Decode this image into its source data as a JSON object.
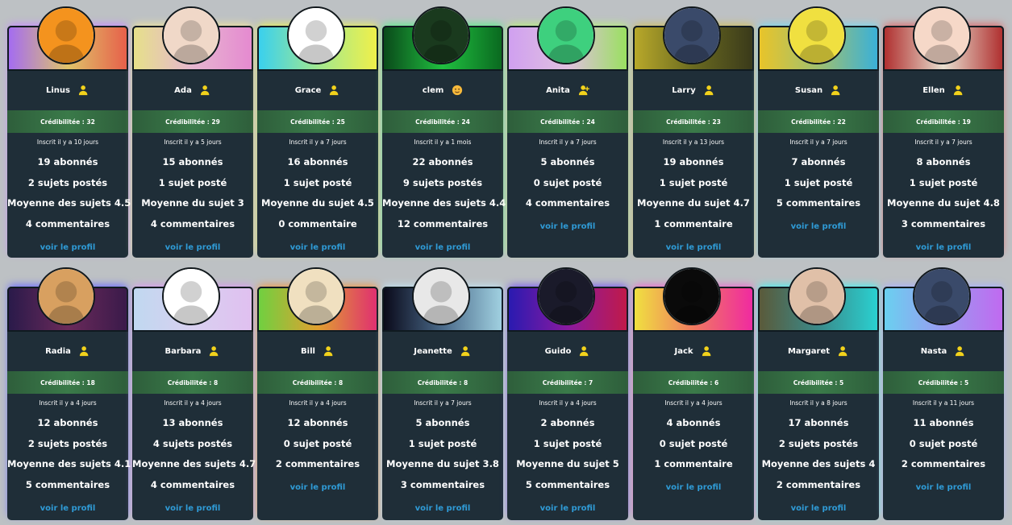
{
  "rows": [
    [
      {
        "name": "Linus",
        "icon": "user-icon",
        "cred": "Crédibilitée : 32",
        "inscrit": "Inscrit il y a 10 jours",
        "stats": [
          "19 abonnés",
          "2 sujets postés",
          "Moyenne des sujets 4.5",
          "4 commentaires"
        ],
        "link": "voir le profil",
        "banner": [
          "#a46cf0",
          "#e0c46a",
          "#e6604a"
        ],
        "glow": "#c78bff",
        "avatar_color": "#f4931e"
      },
      {
        "name": "Ada",
        "icon": "user-icon",
        "cred": "Crédibilitée : 29",
        "inscrit": "Inscrit il y a 5 jours",
        "stats": [
          "15 abonnés",
          "1 sujet posté",
          "Moyenne du sujet 3",
          "4 commentaires"
        ],
        "link": "voir le profil",
        "banner": [
          "#e6e08a",
          "#e6b6d0",
          "#e58ad0"
        ],
        "glow": "#f0e49a",
        "avatar_color": "#f0d8c8"
      },
      {
        "name": "Grace",
        "icon": "user-icon",
        "cred": "Crédibilitée : 25",
        "inscrit": "Inscrit il y a 7 jours",
        "stats": [
          "16 abonnés",
          "1 sujet posté",
          "Moyenne du sujet 4.5",
          "0 commentaire"
        ],
        "link": "voir le profil",
        "banner": [
          "#3ad0ee",
          "#a0e890",
          "#f0f04a"
        ],
        "glow": "#e8f05a",
        "avatar_color": "#ffffff"
      },
      {
        "name": "clem",
        "icon": "emoji-icon",
        "cred": "Crédibilitée : 24",
        "inscrit": "Inscrit il y a 1 mois",
        "stats": [
          "22 abonnés",
          "9 sujets postés",
          "Moyenne des sujets 4.4",
          "12 commentaires"
        ],
        "link": "voir le profil",
        "banner": [
          "#0a4a1a",
          "#20c040",
          "#0a6a20"
        ],
        "glow": "#5af08a",
        "avatar_color": "#1a3a1e"
      },
      {
        "name": "Anita",
        "icon": "user-plus-icon",
        "cred": "Crédibilitée : 24",
        "inscrit": "Inscrit il y a 7 jours",
        "stats": [
          "5 abonnés",
          "0 sujet posté",
          "4 commentaires",
          ""
        ],
        "link": "voir le profil",
        "banner": [
          "#d0a0f0",
          "#e0c0e0",
          "#9ae060"
        ],
        "glow": "#b8f07a",
        "avatar_color": "#3ed07e"
      },
      {
        "name": "Larry",
        "icon": "user-icon",
        "cred": "Crédibilitée : 23",
        "inscrit": "Inscrit il y a 13 jours",
        "stats": [
          "19 abonnés",
          "1 sujet posté",
          "Moyenne du sujet 4.7",
          "1 commentaire"
        ],
        "link": "voir le profil",
        "banner": [
          "#b8a82a",
          "#6a6a20",
          "#3a3a1a"
        ],
        "glow": "#d0c060",
        "avatar_color": "#3a4a6a"
      },
      {
        "name": "Susan",
        "icon": "user-icon",
        "cred": "Crédibilitée : 22",
        "inscrit": "Inscrit il y a 7 jours",
        "stats": [
          "7 abonnés",
          "1 sujet posté",
          "5 commentaires",
          ""
        ],
        "link": "voir le profil",
        "banner": [
          "#e8c42a",
          "#a0c070",
          "#3ab0d8"
        ],
        "glow": "#7ad8f0",
        "avatar_color": "#f0e040"
      },
      {
        "name": "Ellen",
        "icon": "user-icon",
        "cred": "Crédibilitée : 19",
        "inscrit": "Inscrit il y a 7 jours",
        "stats": [
          "8 abonnés",
          "1 sujet posté",
          "Moyenne du sujet 4.8",
          "3 commentaires"
        ],
        "link": "voir le profil",
        "banner": [
          "#b03030",
          "#e8e0d0",
          "#b03030"
        ],
        "glow": "#e06a6a",
        "avatar_color": "#f6d8c8"
      }
    ],
    [
      {
        "name": "Radia",
        "icon": "user-icon",
        "cred": "Crédibilitée : 18",
        "inscrit": "Inscrit il y a 4 jours",
        "stats": [
          "12 abonnés",
          "2 sujets postés",
          "Moyenne des sujets 4.1",
          "5 commentaires"
        ],
        "link": "voir le profil",
        "banner": [
          "#2a1a4a",
          "#6a2a5a",
          "#3a1a4a"
        ],
        "glow": "#6a6aff",
        "avatar_color": "#d8a060"
      },
      {
        "name": "Barbara",
        "icon": "user-icon",
        "cred": "Crédibilitée : 8",
        "inscrit": "Inscrit il y a 4 jours",
        "stats": [
          "13 abonnés",
          "4 sujets postés",
          "Moyenne des sujets 4.7",
          "4 commentaires"
        ],
        "link": "voir le profil",
        "banner": [
          "#c0d8f0",
          "#d8d0f0",
          "#e0c0f0"
        ],
        "glow": "#d89af0",
        "avatar_color": "#ffffff"
      },
      {
        "name": "Bill",
        "icon": "user-icon",
        "cred": "Crédibilitée : 8",
        "inscrit": "Inscrit il y a 4 jours",
        "stats": [
          "12 abonnés",
          "0 sujet posté",
          "2 commentaires",
          ""
        ],
        "link": "voir le profil",
        "banner": [
          "#70d040",
          "#e0a030",
          "#e03070"
        ],
        "glow": "#f09a4a",
        "avatar_color": "#f0e0c0"
      },
      {
        "name": "Jeanette",
        "icon": "user-icon",
        "cred": "Crédibilitée : 8",
        "inscrit": "Inscrit il y a 7 jours",
        "stats": [
          "5 abonnés",
          "1 sujet posté",
          "Moyenne du sujet 3.8",
          "3 commentaires"
        ],
        "link": "voir le profil",
        "banner": [
          "#0a0a1a",
          "#4a6a8a",
          "#a0d0e0"
        ],
        "glow": "#c0e0f0",
        "avatar_color": "#e8e8e8"
      },
      {
        "name": "Guido",
        "icon": "user-icon",
        "cred": "Crédibilitée : 7",
        "inscrit": "Inscrit il y a 4 jours",
        "stats": [
          "2 abonnés",
          "1 sujet posté",
          "Moyenne du sujet 5",
          "5 commentaires"
        ],
        "link": "voir le profil",
        "banner": [
          "#2a1ab0",
          "#8a1aa0",
          "#c01a4a"
        ],
        "glow": "#7a5af0",
        "avatar_color": "#1a1a2a"
      },
      {
        "name": "Jack",
        "icon": "user-icon",
        "cred": "Crédibilitée : 6",
        "inscrit": "Inscrit il y a 4 jours",
        "stats": [
          "4 abonnés",
          "0 sujet posté",
          "1 commentaire",
          ""
        ],
        "link": "voir le profil",
        "banner": [
          "#f0e040",
          "#f07a60",
          "#f02aa0"
        ],
        "glow": "#f06ad0",
        "avatar_color": "#0a0a0a"
      },
      {
        "name": "Margaret",
        "icon": "user-icon",
        "cred": "Crédibilitée : 5",
        "inscrit": "Inscrit il y a 8 jours",
        "stats": [
          "17 abonnés",
          "2 sujets postés",
          "Moyenne des sujets 4",
          "2 commentaires"
        ],
        "link": "voir le profil",
        "banner": [
          "#5a5a3a",
          "#3a8a8a",
          "#2ad0d0"
        ],
        "glow": "#4af0f0",
        "avatar_color": "#e0c0a8"
      },
      {
        "name": "Nasta",
        "icon": "user-icon",
        "cred": "Crédibilitée : 5",
        "inscrit": "Inscrit il y a 11 jours",
        "stats": [
          "11 abonnés",
          "0 sujet posté",
          "2 commentaires",
          ""
        ],
        "link": "voir le profil",
        "banner": [
          "#6ad0f0",
          "#9a9af0",
          "#c06af0"
        ],
        "glow": "#a8b0ff",
        "avatar_color": "#3a4a6a"
      }
    ]
  ]
}
